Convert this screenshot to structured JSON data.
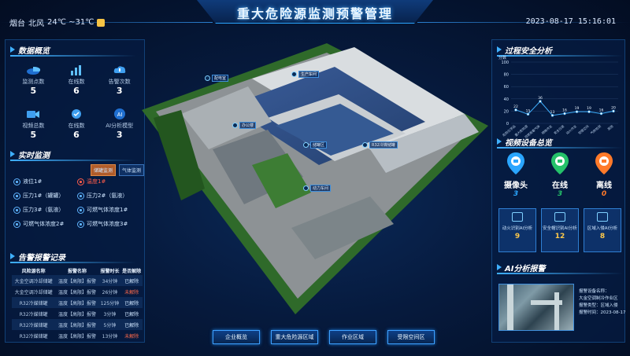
{
  "header": {
    "title": "重大危险源监测预警管理",
    "weather": {
      "city": "烟台",
      "wind": "北风",
      "temp": "24℃ ~31℃"
    },
    "datetime": "2023-08-17  15:16:01"
  },
  "left": {
    "overview_title": "数据概览",
    "overview": [
      {
        "icon": "pie-chart-icon",
        "label": "监测点数",
        "value": "5"
      },
      {
        "icon": "bar-chart-icon",
        "label": "在线数",
        "value": "6"
      },
      {
        "icon": "cloud-alert-icon",
        "label": "告警次数",
        "value": "3"
      },
      {
        "icon": "video-camera-icon",
        "label": "视频总数",
        "value": "5"
      },
      {
        "icon": "online-check-icon",
        "label": "在线数",
        "value": "6"
      },
      {
        "icon": "ai-model-icon",
        "label": "AI分析模型",
        "value": "3"
      }
    ],
    "realtime_title": "实时监测",
    "realtime_tabs": [
      "储罐监测",
      "气体监测"
    ],
    "realtime": [
      {
        "label": "液位1#",
        "alarm": false
      },
      {
        "label": "温度1#",
        "alarm": true
      },
      {
        "label": "压力1#（罐罐）",
        "alarm": false
      },
      {
        "label": "压力2#（氨液）",
        "alarm": false
      },
      {
        "label": "压力3#（氨液）",
        "alarm": false
      },
      {
        "label": "可燃气体浓度1#",
        "alarm": false
      },
      {
        "label": "可燃气体浓度2#",
        "alarm": false
      },
      {
        "label": "可燃气体浓度3#",
        "alarm": false
      }
    ],
    "records_title": "告警报警记录",
    "records_headers": [
      "风险源名称",
      "报警名称",
      "报警时长",
      "是否解除"
    ],
    "records": [
      {
        "source": "大金空调冷却储罐",
        "name": "温度【高限】报警",
        "duration": "34分钟",
        "status": "已解除",
        "open": false
      },
      {
        "source": "大金空调冷却储罐",
        "name": "温度【高限】报警",
        "duration": "26分钟",
        "status": "未解除",
        "open": true
      },
      {
        "source": "R32冷媒储罐",
        "name": "温度【高限】报警",
        "duration": "125分钟",
        "status": "已解除",
        "open": false
      },
      {
        "source": "R32冷媒储罐",
        "name": "温度【高限】报警",
        "duration": "3分钟",
        "status": "已解除",
        "open": false
      },
      {
        "source": "R32冷媒储罐",
        "name": "温度【高限】报警",
        "duration": "5分钟",
        "status": "已解除",
        "open": false
      },
      {
        "source": "R32冷媒储罐",
        "name": "温度【高限】报警",
        "duration": "13分钟",
        "status": "未解除",
        "open": true
      }
    ]
  },
  "map": {
    "pins": [
      {
        "label": "配电室"
      },
      {
        "label": "生产车间"
      },
      {
        "label": "办公楼"
      },
      {
        "label": "储罐区"
      },
      {
        "label": "R32冷媒储罐"
      },
      {
        "label": "动力车间"
      }
    ]
  },
  "nav": [
    "企业概览",
    "重大危险源区域",
    "作业区域",
    "受限空间区"
  ],
  "right": {
    "process_title": "过程安全分析",
    "video_title": "视频设备总览",
    "devices": [
      {
        "label": "摄像头",
        "value": "3",
        "color": "#2aa6ff",
        "icon": "camera-pin-icon"
      },
      {
        "label": "在线",
        "value": "3",
        "color": "#25c26a",
        "icon": "online-pin-icon"
      },
      {
        "label": "离线",
        "value": "0",
        "color": "#ff7a2a",
        "icon": "offline-pin-icon"
      }
    ],
    "ai_cards": [
      {
        "label": "动火识别AI分析",
        "value": "9"
      },
      {
        "label": "安全帽识别AI分析",
        "value": "12"
      },
      {
        "label": "区域入侵AI分析",
        "value": "8"
      }
    ],
    "alarm_title": "AI分析报警",
    "alarm_info": [
      "报警设备名称：",
      "大金空调制冷作业区",
      "报警类型：区域入侵",
      "报警时间：2023-08-17"
    ]
  },
  "chart_data": {
    "type": "line",
    "title": "",
    "ylabel": "分数",
    "ylim": [
      0,
      100
    ],
    "yticks": [
      0,
      20,
      40,
      60,
      80,
      100
    ],
    "categories": [
      "危险化学品",
      "重大危险源",
      "可燃有毒气体",
      "特殊作业",
      "安全仪表",
      "动火作业",
      "受限空间",
      "气体检测",
      "其他"
    ],
    "values": [
      22,
      15,
      36,
      13,
      16,
      19,
      19,
      16,
      20
    ]
  }
}
